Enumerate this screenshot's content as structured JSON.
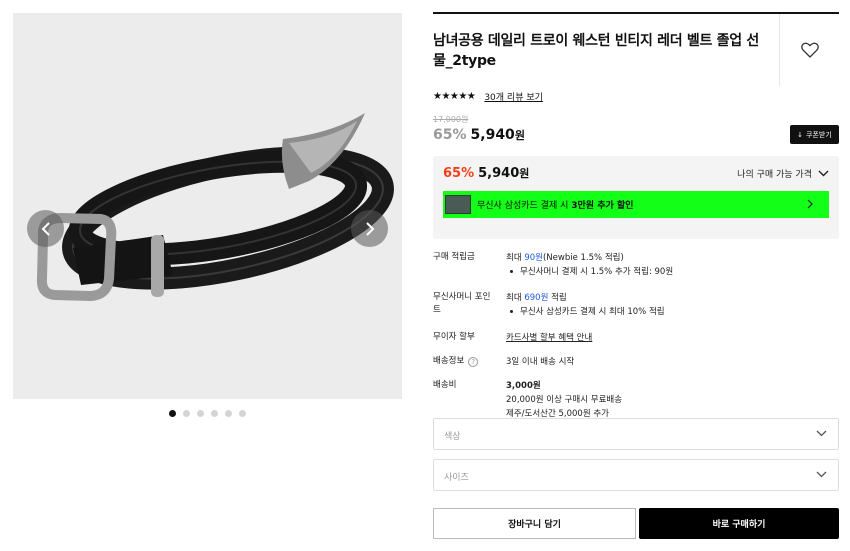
{
  "product": {
    "title": "남녀공용 데일리 트로이 웨스턴 빈티지 레더 벨트 졸업 선물_2type",
    "stars": "★★★★★",
    "review_link": "30개 리뷰 보기",
    "original_price": "17,000원",
    "discount_rate": "65%",
    "sale_price": "5,940",
    "won": "원",
    "coupon_button": "쿠폰받기",
    "coupon_icon": "↓"
  },
  "benefit": {
    "discount_rate": "65%",
    "price": "5,940",
    "won": "원",
    "my_price_label": "나의 구매 가능 가격",
    "promo_prefix": "무신사 삼성카드 결제 시 ",
    "promo_bold": "3만원 추가 할인",
    "promo_color": "#14ff18"
  },
  "details": {
    "points_label": "구매 적립금",
    "points_prefix": "최대 ",
    "points_amount": "90원",
    "points_suffix": "(Newbie 1.5% 적립)",
    "points_bullet": "무신사머니 결제 시 1.5% 추가 적립: 90원",
    "money_label": "무신사머니 포인트",
    "money_prefix": "최대 ",
    "money_amount": "690원",
    "money_suffix": " 적립",
    "money_bullet": "무신사 삼성카드 결제 시 최대 10% 적립",
    "installment_label": "무이자 할부",
    "installment_link": "카드사별 할부 혜택 안내",
    "shipping_info_label": "배송정보",
    "shipping_info_help": "?",
    "shipping_info_value": "3일 이내 배송 시작",
    "shipping_fee_label": "배송비",
    "shipping_fee_value": "3,000원",
    "shipping_fee_line2": "20,000원 이상 구매시 무료배송",
    "shipping_fee_line3": "제주/도서산간 5,000원 추가"
  },
  "options": {
    "color_placeholder": "색상",
    "size_placeholder": "사이즈"
  },
  "actions": {
    "cart_button": "장바구니 담기",
    "buy_button": "바로 구매하기"
  },
  "gallery": {
    "image_count": 6,
    "active_index": 0,
    "background": "#ececec"
  },
  "colors": {
    "accent_red": "#f5401b",
    "link_blue": "#1a5bd6"
  },
  "icons": [
    "heart-icon",
    "chevron-left-icon",
    "chevron-right-icon",
    "chevron-down-icon",
    "download-icon",
    "card-icon",
    "help-icon"
  ]
}
